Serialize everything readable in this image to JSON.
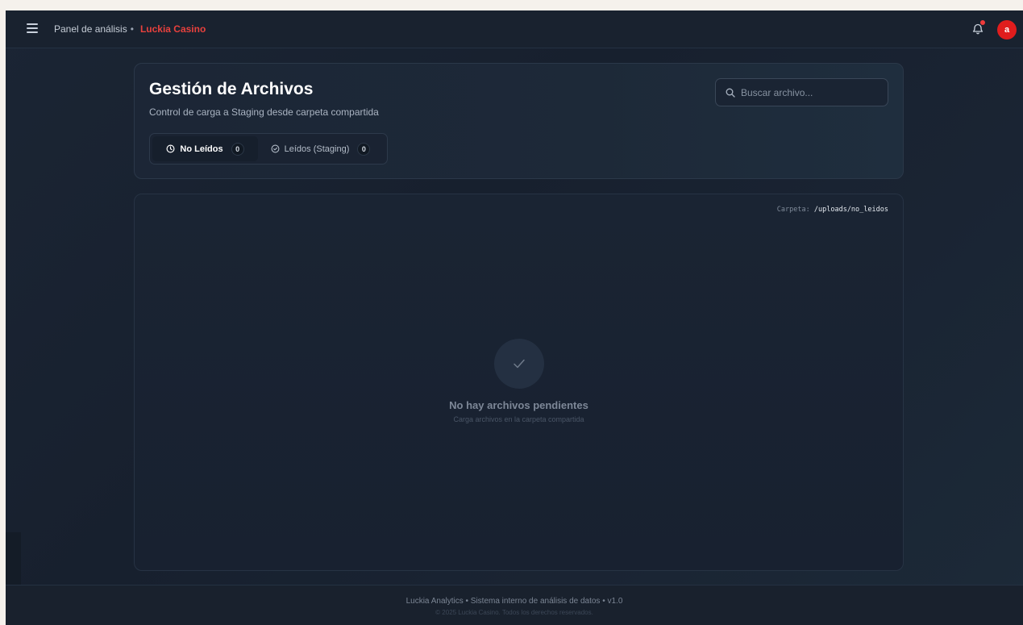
{
  "topbar": {
    "breadcrumb_section": "Panel de análisis",
    "breadcrumb_separator": "•",
    "brand": "Luckia Casino",
    "avatar_initial": "a",
    "icons": {
      "menu": "hamburger-icon",
      "notifications": "bell-icon"
    },
    "notification_dot_color": "#ef3b3b",
    "brand_color": "#e8413d"
  },
  "header": {
    "title": "Gestión de Archivos",
    "subtitle": "Control de carga a Staging desde carpeta compartida",
    "search_placeholder": "Buscar archivo...",
    "tabs": [
      {
        "label": "No Leídos",
        "count": "0",
        "icon": "clock-icon",
        "active": true
      },
      {
        "label": "Leídos (Staging)",
        "count": "0",
        "icon": "check-circle-icon",
        "active": false
      }
    ]
  },
  "files": {
    "folder_label": "Carpeta:",
    "folder_path": "/uploads/no_leidos",
    "empty_icon": "check-icon",
    "empty_title": "No hay archivos pendientes",
    "empty_subtitle": "Carga archivos en la carpeta compartida"
  },
  "footer": {
    "line1": "Luckia Analytics • Sistema interno de análisis de datos • v1.0",
    "line2": "© 2025 Luckia Casino. Todos los derechos reservados."
  }
}
